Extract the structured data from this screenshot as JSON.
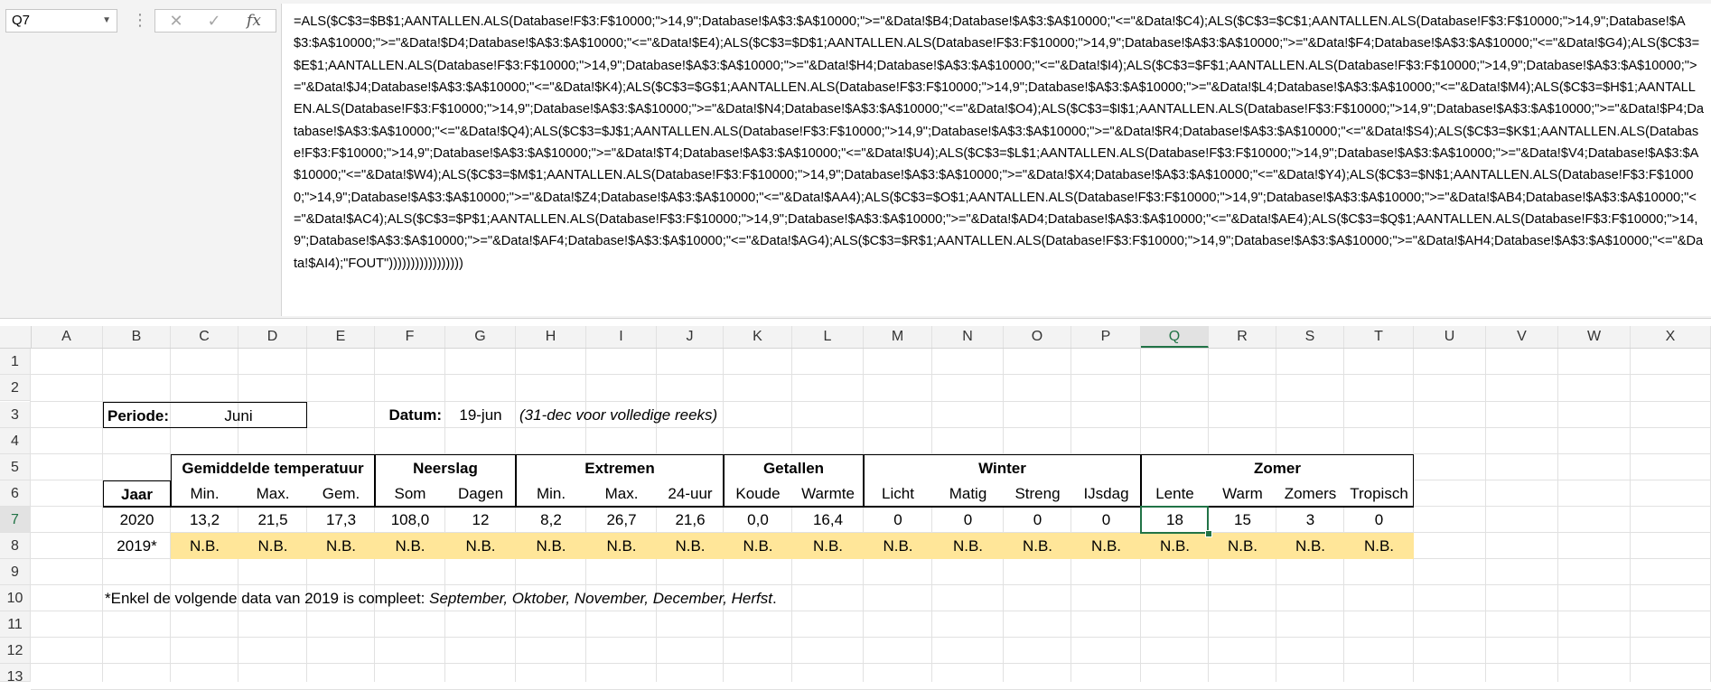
{
  "formula_bar": {
    "name_box": "Q7",
    "cancel_icon": "x-icon",
    "enter_icon": "check-icon",
    "fx_label": "fx",
    "formula": "=ALS($C$3=$B$1;AANTALLEN.ALS(Database!F$3:F$10000;\">14,9\";Database!$A$3:$A$10000;\">=\"&Data!$B4;Database!$A$3:$A$10000;\"<=\"&Data!$C4);ALS($C$3=$C$1;AANTALLEN.ALS(Database!F$3:F$10000;\">14,9\";Database!$A$3:$A$10000;\">=\"&Data!$D4;Database!$A$3:$A$10000;\"<=\"&Data!$E4);ALS($C$3=$D$1;AANTALLEN.ALS(Database!F$3:F$10000;\">14,9\";Database!$A$3:$A$10000;\">=\"&Data!$F4;Database!$A$3:$A$10000;\"<=\"&Data!$G4);ALS($C$3=$E$1;AANTALLEN.ALS(Database!F$3:F$10000;\">14,9\";Database!$A$3:$A$10000;\">=\"&Data!$H4;Database!$A$3:$A$10000;\"<=\"&Data!$I4);ALS($C$3=$F$1;AANTALLEN.ALS(Database!F$3:F$10000;\">14,9\";Database!$A$3:$A$10000;\">=\"&Data!$J4;Database!$A$3:$A$10000;\"<=\"&Data!$K4);ALS($C$3=$G$1;AANTALLEN.ALS(Database!F$3:F$10000;\">14,9\";Database!$A$3:$A$10000;\">=\"&Data!$L4;Database!$A$3:$A$10000;\"<=\"&Data!$M4);ALS($C$3=$H$1;AANTALLEN.ALS(Database!F$3:F$10000;\">14,9\";Database!$A$3:$A$10000;\">=\"&Data!$N4;Database!$A$3:$A$10000;\"<=\"&Data!$O4);ALS($C$3=$I$1;AANTALLEN.ALS(Database!F$3:F$10000;\">14,9\";Database!$A$3:$A$10000;\">=\"&Data!$P4;Database!$A$3:$A$10000;\"<=\"&Data!$Q4);ALS($C$3=$J$1;AANTALLEN.ALS(Database!F$3:F$10000;\">14,9\";Database!$A$3:$A$10000;\">=\"&Data!$R4;Database!$A$3:$A$10000;\"<=\"&Data!$S4);ALS($C$3=$K$1;AANTALLEN.ALS(Database!F$3:F$10000;\">14,9\";Database!$A$3:$A$10000;\">=\"&Data!$T4;Database!$A$3:$A$10000;\"<=\"&Data!$U4);ALS($C$3=$L$1;AANTALLEN.ALS(Database!F$3:F$10000;\">14,9\";Database!$A$3:$A$10000;\">=\"&Data!$V4;Database!$A$3:$A$10000;\"<=\"&Data!$W4);ALS($C$3=$M$1;AANTALLEN.ALS(Database!F$3:F$10000;\">14,9\";Database!$A$3:$A$10000;\">=\"&Data!$X4;Database!$A$3:$A$10000;\"<=\"&Data!$Y4);ALS($C$3=$N$1;AANTALLEN.ALS(Database!F$3:F$10000;\">14,9\";Database!$A$3:$A$10000;\">=\"&Data!$Z4;Database!$A$3:$A$10000;\"<=\"&Data!$AA4);ALS($C$3=$O$1;AANTALLEN.ALS(Database!F$3:F$10000;\">14,9\";Database!$A$3:$A$10000;\">=\"&Data!$AB4;Database!$A$3:$A$10000;\"<=\"&Data!$AC4);ALS($C$3=$P$1;AANTALLEN.ALS(Database!F$3:F$10000;\">14,9\";Database!$A$3:$A$10000;\">=\"&Data!$AD4;Database!$A$3:$A$10000;\"<=\"&Data!$AE4);ALS($C$3=$Q$1;AANTALLEN.ALS(Database!F$3:F$10000;\">14,9\";Database!$A$3:$A$10000;\">=\"&Data!$AF4;Database!$A$3:$A$10000;\"<=\"&Data!$AG4);ALS($C$3=$R$1;AANTALLEN.ALS(Database!F$3:F$10000;\">14,9\";Database!$A$3:$A$10000;\">=\"&Data!$AH4;Database!$A$3:$A$10000;\"<=\"&Data!$AI4);\"FOUT\")))))))))))))))))"
  },
  "columns": [
    "A",
    "B",
    "C",
    "D",
    "E",
    "F",
    "G",
    "H",
    "I",
    "J",
    "K",
    "L",
    "M",
    "N",
    "O",
    "P",
    "Q",
    "R",
    "S",
    "T",
    "U",
    "V",
    "W",
    "X"
  ],
  "rows": [
    "1",
    "2",
    "3",
    "4",
    "5",
    "6",
    "7",
    "8",
    "9",
    "10",
    "11",
    "12",
    "13"
  ],
  "selected": {
    "column": "Q",
    "row": "7"
  },
  "sheet": {
    "periode_label": "Periode:",
    "periode_value": "Juni",
    "datum_label": "Datum:",
    "datum_value": "19-jun",
    "datum_note": "(31-dec voor volledige reeks)",
    "groups": {
      "temp": "Gemiddelde temperatuur",
      "neerslag": "Neerslag",
      "extremen": "Extremen",
      "getallen": "Getallen",
      "winter": "Winter",
      "zomer": "Zomer"
    },
    "year_header": "Jaar",
    "subheaders": [
      "Min.",
      "Max.",
      "Gem.",
      "Som",
      "Dagen",
      "Min.",
      "Max.",
      "24-uur",
      "Koude",
      "Warmte",
      "Licht",
      "Matig",
      "Streng",
      "IJsdag",
      "Lente",
      "Warm",
      "Zomers",
      "Tropisch"
    ],
    "row_2020": {
      "year": "2020",
      "values": [
        "13,2",
        "21,5",
        "17,3",
        "108,0",
        "12",
        "8,2",
        "26,7",
        "21,6",
        "0,0",
        "16,4",
        "0",
        "0",
        "0",
        "0",
        "18",
        "15",
        "3",
        "0"
      ]
    },
    "row_2019": {
      "year": "2019*",
      "values": [
        "N.B.",
        "N.B.",
        "N.B.",
        "N.B.",
        "N.B.",
        "N.B.",
        "N.B.",
        "N.B.",
        "N.B.",
        "N.B.",
        "N.B.",
        "N.B.",
        "N.B.",
        "N.B.",
        "N.B.",
        "N.B.",
        "N.B.",
        "N.B."
      ]
    },
    "footnote_prefix": "*Enkel de volgende data van 2019 is compleet: ",
    "footnote_months": "September, Oktober, November, December, Herfst",
    "footnote_suffix": "."
  },
  "colors": {
    "selection": "#217346",
    "highlight_row": "#ffe699"
  }
}
